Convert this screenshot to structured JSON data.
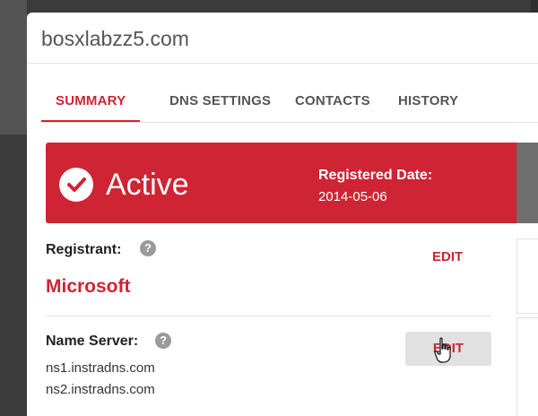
{
  "domain": {
    "title": "bosxlabzz5.com"
  },
  "tabs": [
    {
      "label": "SUMMARY",
      "active": true
    },
    {
      "label": "DNS SETTINGS",
      "active": false
    },
    {
      "label": "CONTACTS",
      "active": false
    },
    {
      "label": "HISTORY",
      "active": false
    }
  ],
  "status": {
    "text": "Active",
    "registered_label": "Registered Date:",
    "registered_date": "2014-05-06",
    "color": "#cf2434"
  },
  "registrant": {
    "label": "Registrant:",
    "help_symbol": "?",
    "name": "Microsoft",
    "edit_label": "EDIT"
  },
  "name_server": {
    "label": "Name Server:",
    "help_symbol": "?",
    "edit_label": "EDIT",
    "servers": [
      "ns1.instradns.com",
      "ns2.instradns.com"
    ]
  },
  "icons": {
    "status": "check-circle-icon",
    "help": "question-circle-icon",
    "pointer": "hand-pointer-cursor-icon"
  }
}
